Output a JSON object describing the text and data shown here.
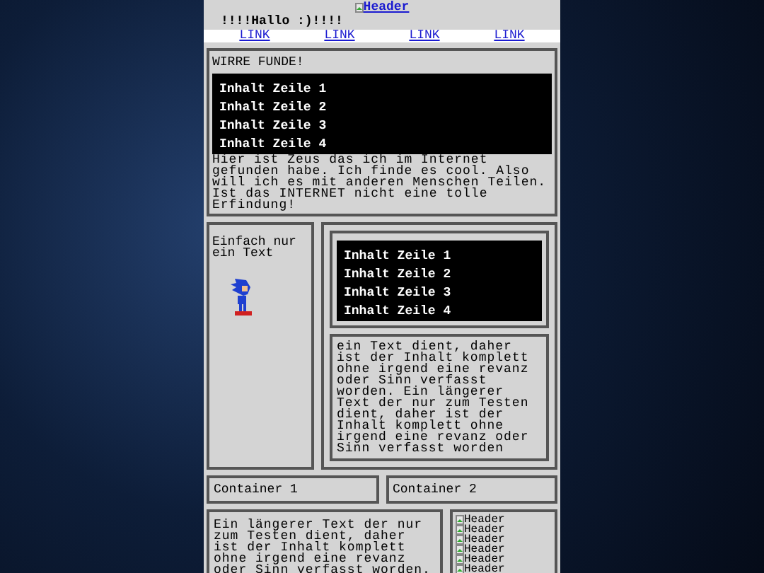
{
  "header_image": {
    "alt": "Header"
  },
  "greeting": "!!!!Hallo :)!!!!",
  "nav": [
    "LINK",
    "LINK",
    "LINK",
    "LINK"
  ],
  "finds": {
    "title": "WIRRE FUNDE!",
    "list": [
      "Inhalt Zeile 1",
      "Inhalt Zeile 2",
      "Inhalt Zeile 3",
      "Inhalt Zeile 4"
    ],
    "text": "Hier ist Zeus das ich im Internet gefunden habe. Ich finde es cool. Also will ich es mit anderen Menschen Teilen. Ist das INTERNET nicht eine tolle Erfindung!"
  },
  "middle": {
    "side_text": "Einfach nur ein Text",
    "list": [
      "Inhalt Zeile 1",
      "Inhalt Zeile 2",
      "Inhalt Zeile 3",
      "Inhalt Zeile 4"
    ],
    "text": "ein Text dient, daher ist der Inhalt komplett ohne irgend eine revanz oder Sinn verfasst worden. Ein längerer Text der nur zum Testen dient, daher ist der Inhalt komplett ohne irgend eine revanz oder Sinn verfasst worden"
  },
  "containers": [
    "Container 1",
    "Container 2"
  ],
  "bottom": {
    "text": "Ein längerer Text der nur zum Testen dient, daher ist der Inhalt komplett ohne irgend eine revanz oder Sinn verfasst worden.",
    "images": [
      "Header",
      "Header",
      "Header",
      "Header",
      "Header",
      "Header"
    ]
  }
}
